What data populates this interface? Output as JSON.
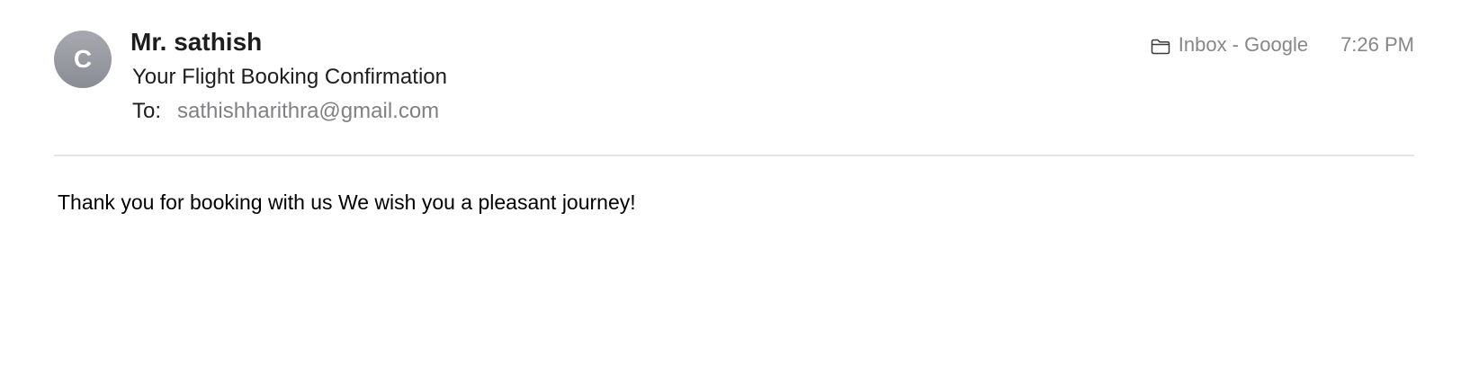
{
  "message": {
    "avatar_initial": "C",
    "sender_name": "Mr. sathish",
    "subject": "Your Flight Booking Confirmation",
    "to_label": "To:",
    "to_address": "sathishharithra@gmail.com",
    "mailbox": "Inbox - Google",
    "mailbox_icon": "folder-icon",
    "time": "7:26 PM",
    "body": "Thank you for booking with us We wish you a pleasant journey!"
  },
  "colors": {
    "avatar": "#9a9ba3",
    "primary_text": "#1d1d1f",
    "secondary_text": "#86868b",
    "divider": "#e5e5e7"
  }
}
